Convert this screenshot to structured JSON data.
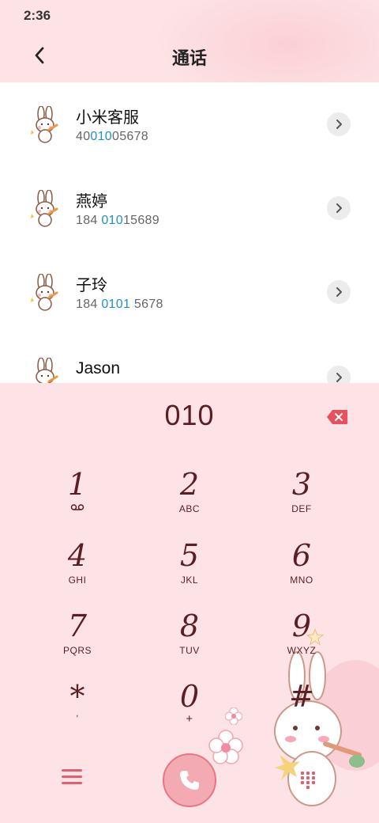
{
  "status_bar": {
    "time": "2:36"
  },
  "header": {
    "title": "通话"
  },
  "contacts": [
    {
      "name": "小米客服",
      "number_parts": [
        "40",
        "010",
        "05678"
      ]
    },
    {
      "name": "燕婷",
      "number_parts": [
        "184 ",
        "010",
        "15689"
      ]
    },
    {
      "name": "子玲",
      "number_parts": [
        "184 ",
        "0101",
        " 5678"
      ]
    },
    {
      "name": "Jason",
      "number_parts": [
        "",
        "",
        ""
      ]
    }
  ],
  "dialer": {
    "input": "010",
    "keys": [
      {
        "digit": "1",
        "letters": ""
      },
      {
        "digit": "2",
        "letters": "ABC"
      },
      {
        "digit": "3",
        "letters": "DEF"
      },
      {
        "digit": "4",
        "letters": "GHI"
      },
      {
        "digit": "5",
        "letters": "JKL"
      },
      {
        "digit": "6",
        "letters": "MNO"
      },
      {
        "digit": "7",
        "letters": "PQRS"
      },
      {
        "digit": "8",
        "letters": "TUV"
      },
      {
        "digit": "9",
        "letters": "WXYZ"
      },
      {
        "digit": "*",
        "letters": ","
      },
      {
        "digit": "0",
        "letters": "+"
      },
      {
        "digit": "#",
        "letters": ""
      }
    ]
  },
  "colors": {
    "accent": "#e0606f",
    "highlight_number": "#1f8fd1",
    "dial_text": "#5a1e23",
    "dialer_bg": "#fde3e6"
  },
  "icons": {
    "back": "back-arrow-icon",
    "info": "chevron-right-icon",
    "backspace": "backspace-icon",
    "voicemail": "voicemail-icon",
    "menu": "menu-icon",
    "call": "phone-icon",
    "keypad": "keypad-icon"
  }
}
